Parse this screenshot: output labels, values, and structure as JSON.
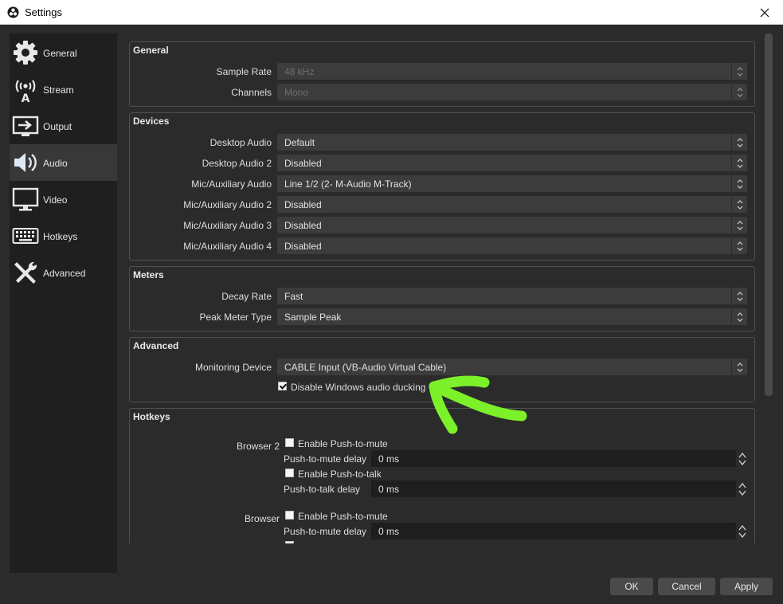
{
  "window": {
    "title": "Settings"
  },
  "sidebar": {
    "items": [
      {
        "label": "General",
        "icon": "gear-icon"
      },
      {
        "label": "Stream",
        "icon": "broadcast-icon"
      },
      {
        "label": "Output",
        "icon": "output-icon"
      },
      {
        "label": "Audio",
        "icon": "speaker-icon",
        "active": true
      },
      {
        "label": "Video",
        "icon": "monitor-icon"
      },
      {
        "label": "Hotkeys",
        "icon": "keyboard-icon"
      },
      {
        "label": "Advanced",
        "icon": "tools-icon"
      }
    ]
  },
  "general": {
    "title": "General",
    "sample_rate": {
      "label": "Sample Rate",
      "value": "48 kHz"
    },
    "channels": {
      "label": "Channels",
      "value": "Mono"
    }
  },
  "devices": {
    "title": "Devices",
    "rows": [
      {
        "label": "Desktop Audio",
        "value": "Default"
      },
      {
        "label": "Desktop Audio 2",
        "value": "Disabled"
      },
      {
        "label": "Mic/Auxiliary Audio",
        "value": "Line 1/2 (2- M-Audio M-Track)"
      },
      {
        "label": "Mic/Auxiliary Audio 2",
        "value": "Disabled"
      },
      {
        "label": "Mic/Auxiliary Audio 3",
        "value": "Disabled"
      },
      {
        "label": "Mic/Auxiliary Audio 4",
        "value": "Disabled"
      }
    ]
  },
  "meters": {
    "title": "Meters",
    "decay_rate": {
      "label": "Decay Rate",
      "value": "Fast"
    },
    "peak_meter_type": {
      "label": "Peak Meter Type",
      "value": "Sample Peak"
    }
  },
  "advanced": {
    "title": "Advanced",
    "monitoring_device": {
      "label": "Monitoring Device",
      "value": "CABLE Input (VB-Audio Virtual Cable)"
    },
    "ducking": {
      "label": "Disable Windows audio ducking",
      "checked": true
    }
  },
  "hotkeys": {
    "title": "Hotkeys",
    "sources": [
      {
        "name": "Browser 2",
        "push_to_mute": "Enable Push-to-mute",
        "push_to_mute_delay": {
          "label": "Push-to-mute delay",
          "value": "0 ms"
        },
        "push_to_talk": "Enable Push-to-talk",
        "push_to_talk_delay": {
          "label": "Push-to-talk delay",
          "value": "0 ms"
        }
      },
      {
        "name": "Browser",
        "push_to_mute": "Enable Push-to-mute",
        "push_to_mute_delay": {
          "label": "Push-to-mute delay",
          "value": "0 ms"
        }
      }
    ]
  },
  "buttons": {
    "ok": "OK",
    "cancel": "Cancel",
    "apply": "Apply"
  },
  "annotation": {
    "arrow_color": "#7cf12a"
  },
  "colors": {
    "background": "#2b2b2b",
    "sidebar": "#1f1f1f",
    "active_nav": "#383838"
  }
}
